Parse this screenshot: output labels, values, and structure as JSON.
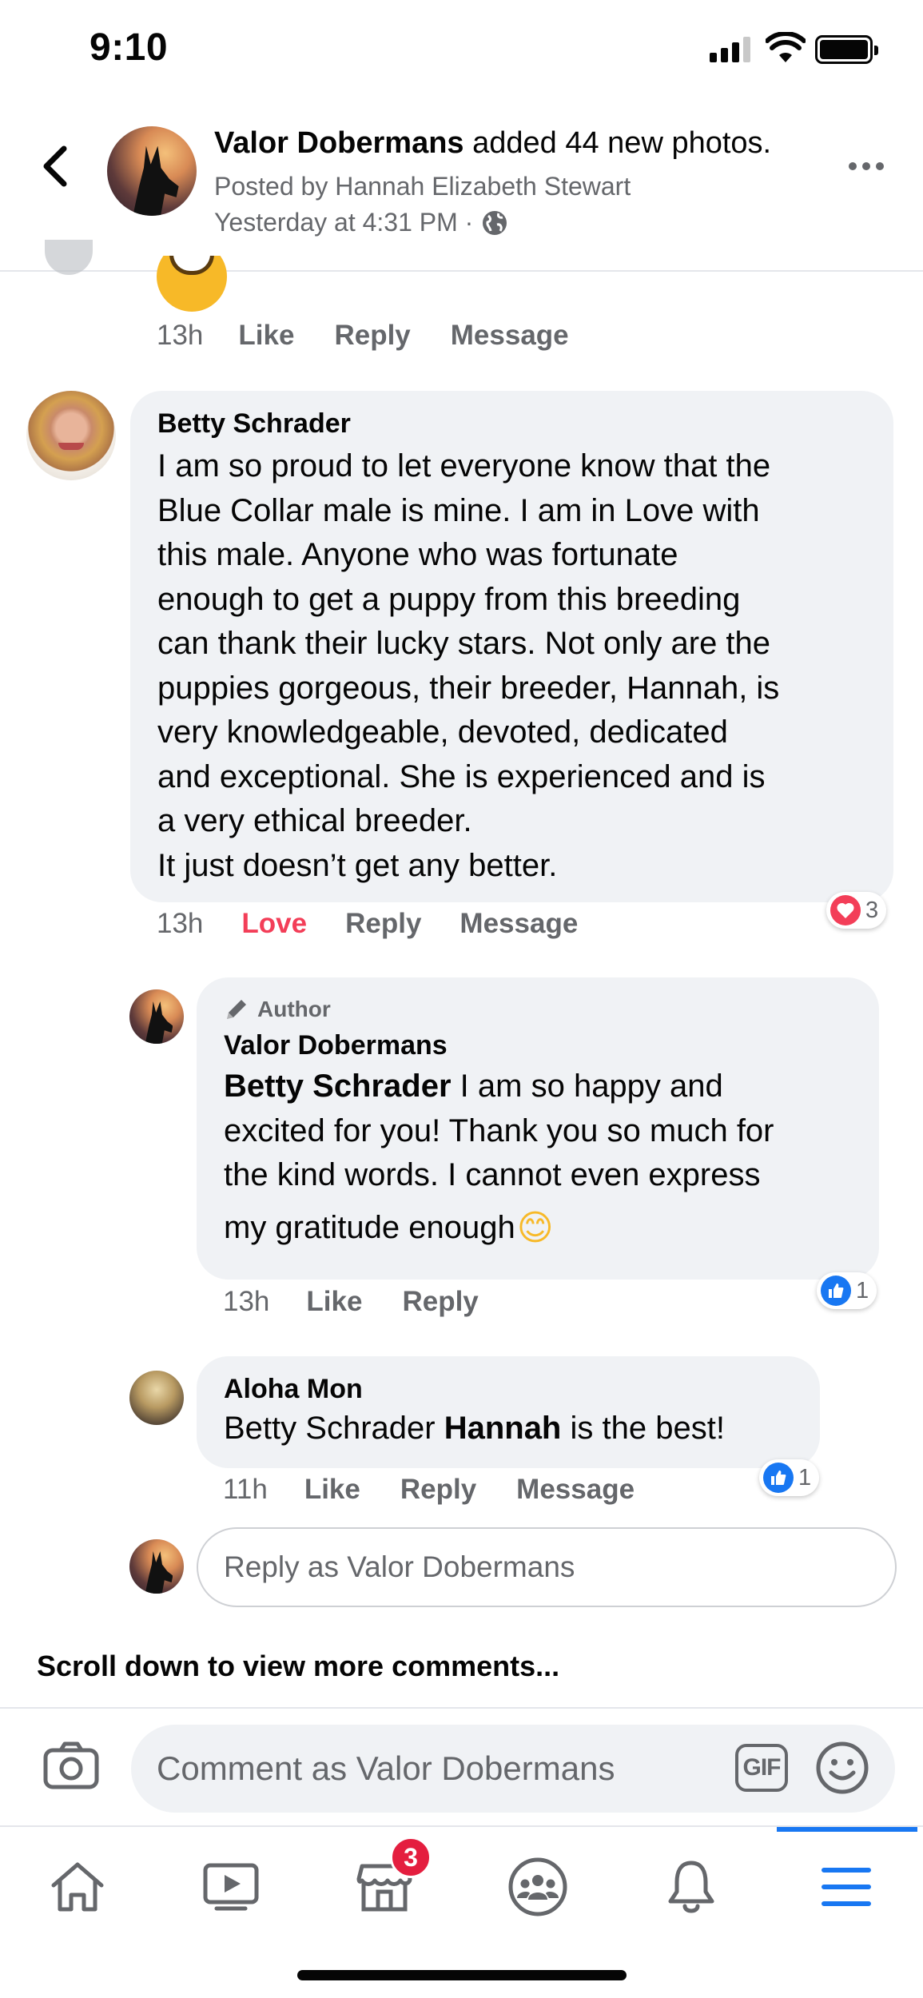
{
  "status_bar": {
    "time": "9:10"
  },
  "header": {
    "page_name": "Valor Dobermans",
    "action": " added 44 new photos.",
    "posted_by": "Posted by Hannah Elizabeth Stewart",
    "timestamp": "Yesterday at 4:31 PM ·"
  },
  "comments": [
    {
      "time": "13h",
      "like": "Like",
      "reply": "Reply",
      "message": "Message"
    },
    {
      "author": "Betty Schrader",
      "lines": [
        "I am so proud to let everyone know that the",
        "Blue Collar male is mine.  I am in Love with",
        "this male. Anyone who was fortunate",
        "enough to get a puppy from this breeding",
        "can thank their lucky stars.  Not only are the",
        "puppies gorgeous, their breeder, Hannah, is",
        "very knowledgeable, devoted, dedicated",
        "and exceptional.  She is experienced and is",
        "a very ethical breeder.",
        "It just doesn’t get any better."
      ],
      "time": "13h",
      "reaction_label": "Love",
      "reply": "Reply",
      "message": "Message",
      "reaction_count": "3"
    }
  ],
  "replies": [
    {
      "badge": "Author",
      "author": "Valor Dobermans",
      "mention": "Betty Schrader",
      "lines": [
        " I am so happy and",
        "excited for you! Thank you so much for",
        "the kind words. I cannot even express",
        "my gratitude enough"
      ],
      "emoji": "😊",
      "time": "13h",
      "like": "Like",
      "reply": "Reply",
      "reaction_count": "1"
    },
    {
      "author": "Aloha Mon",
      "text_prefix": "Betty Schrader ",
      "text_bold": "Hannah",
      "text_suffix": " is the best!",
      "time": "11h",
      "like": "Like",
      "reply": "Reply",
      "message": "Message",
      "reaction_count": "1"
    }
  ],
  "reply_box": {
    "placeholder": "Reply as Valor Dobermans"
  },
  "scroll_more": "Scroll down to view more comments...",
  "composer": {
    "placeholder": "Comment as Valor Dobermans",
    "gif_label": "GIF"
  },
  "tab_bar": {
    "tabs": [
      "home-icon",
      "watch-icon",
      "marketplace-icon",
      "groups-icon",
      "notifications-icon",
      "menu-icon"
    ],
    "marketplace_badge": "3",
    "active_color": "#1877f2"
  },
  "colors": {
    "love": "#f33e58",
    "like": "#1877f2",
    "secondary_text": "#65676b",
    "bubble": "#f0f2f5"
  }
}
